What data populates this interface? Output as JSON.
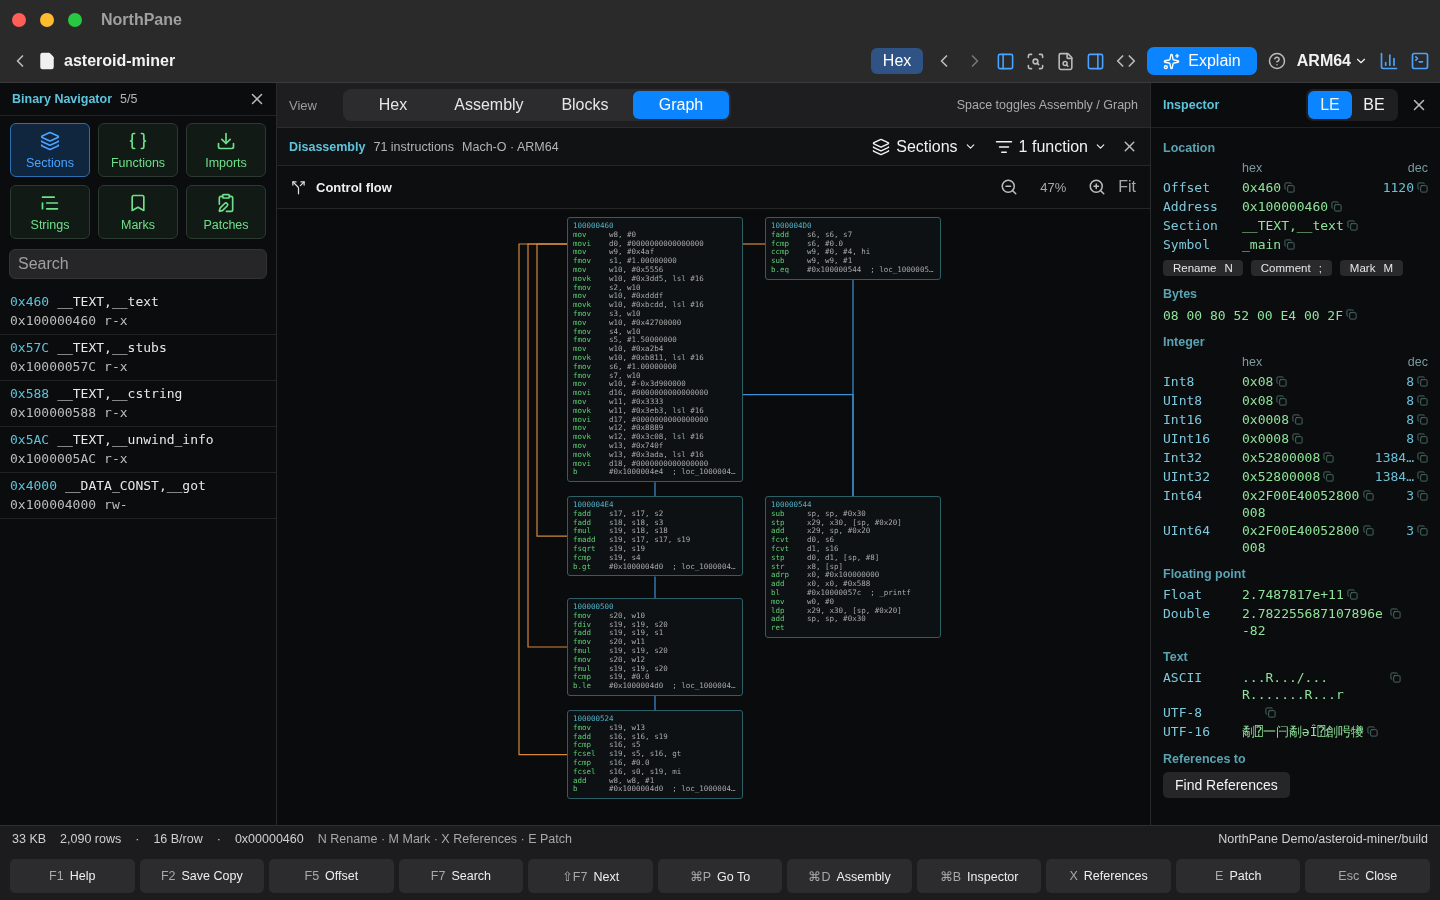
{
  "app": {
    "title": "NorthPane"
  },
  "toolbar": {
    "file_name": "asteroid-miner",
    "mode": "Hex",
    "explain": "Explain",
    "arch": "ARM64"
  },
  "navigator": {
    "title": "Binary Navigator",
    "count": "5/5",
    "categories": [
      {
        "label": "Sections",
        "selected": true
      },
      {
        "label": "Functions",
        "selected": false
      },
      {
        "label": "Imports",
        "selected": false
      },
      {
        "label": "Strings",
        "selected": false
      },
      {
        "label": "Marks",
        "selected": false
      },
      {
        "label": "Patches",
        "selected": false
      }
    ],
    "search": {
      "placeholder": "Search"
    },
    "sections": [
      {
        "offset": "0x460",
        "name": "__TEXT,__text",
        "address": "0x100000460",
        "perms": "r-x"
      },
      {
        "offset": "0x57C",
        "name": "__TEXT,__stubs",
        "address": "0x10000057C",
        "perms": "r-x"
      },
      {
        "offset": "0x588",
        "name": "__TEXT,__cstring",
        "address": "0x100000588",
        "perms": "r-x"
      },
      {
        "offset": "0x5AC",
        "name": "__TEXT,__unwind_info",
        "address": "0x1000005AC",
        "perms": "r-x"
      },
      {
        "offset": "0x4000",
        "name": "__DATA_CONST,__got",
        "address": "0x100004000",
        "perms": "rw-"
      }
    ]
  },
  "view_bar": {
    "label": "View",
    "tabs": [
      {
        "label": "Hex",
        "selected": false
      },
      {
        "label": "Assembly",
        "selected": false
      },
      {
        "label": "Blocks",
        "selected": false
      },
      {
        "label": "Graph",
        "selected": true
      }
    ],
    "hint": "Space toggles Assembly / Graph"
  },
  "disassembly": {
    "title": "Disassembly",
    "count": "71 instructions",
    "format": "Mach-O · ARM64",
    "sections_filter": "Sections",
    "function_filter": "1 function"
  },
  "graph": {
    "title": "Control flow",
    "zoom": "47%",
    "fit": "Fit",
    "blocks": [
      {
        "address": "100000460",
        "instructions": [
          {
            "op": "mov",
            "args": "w8, #0"
          },
          {
            "op": "movi",
            "args": "d0, #0000000000000000"
          },
          {
            "op": "mov",
            "args": "w9, #0x4af"
          },
          {
            "op": "fmov",
            "args": "s1, #1.00000000"
          },
          {
            "op": "mov",
            "args": "w10, #0x5556"
          },
          {
            "op": "movk",
            "args": "w10, #0x3dd5, lsl #16"
          },
          {
            "op": "fmov",
            "args": "s2, w10"
          },
          {
            "op": "mov",
            "args": "w10, #0xdddf"
          },
          {
            "op": "movk",
            "args": "w10, #0xbcdd, lsl #16"
          },
          {
            "op": "fmov",
            "args": "s3, w10"
          },
          {
            "op": "mov",
            "args": "w10, #0x42700000"
          },
          {
            "op": "fmov",
            "args": "s4, w10"
          },
          {
            "op": "fmov",
            "args": "s5, #1.50000000"
          },
          {
            "op": "mov",
            "args": "w10, #0xa2b4"
          },
          {
            "op": "movk",
            "args": "w10, #0xb811, lsl #16"
          },
          {
            "op": "fmov",
            "args": "s6, #1.00000000"
          },
          {
            "op": "fmov",
            "args": "s7, w10"
          },
          {
            "op": "mov",
            "args": "w10, #-0x3d900000"
          },
          {
            "op": "movi",
            "args": "d16, #0000000000000000"
          },
          {
            "op": "mov",
            "args": "w11, #0x3333"
          },
          {
            "op": "movk",
            "args": "w11, #0x3eb3, lsl #16"
          },
          {
            "op": "movi",
            "args": "d17, #0000000000000000"
          },
          {
            "op": "mov",
            "args": "w12, #0x8889"
          },
          {
            "op": "movk",
            "args": "w12, #0x3c08, lsl #16"
          },
          {
            "op": "mov",
            "args": "w13, #0x740f"
          },
          {
            "op": "movk",
            "args": "w13, #0x3ada, lsl #16"
          },
          {
            "op": "movi",
            "args": "d18, #0000000000000000"
          },
          {
            "op": "b",
            "args": "#0x1000004e4  ; loc_1000004…"
          }
        ]
      },
      {
        "address": "1000004D0",
        "instructions": [
          {
            "op": "fadd",
            "args": "s6, s6, s7"
          },
          {
            "op": "fcmp",
            "args": "s6, #0.0"
          },
          {
            "op": "ccmp",
            "args": "w9, #0, #4, hi"
          },
          {
            "op": "sub",
            "args": "w9, w9, #1"
          },
          {
            "op": "b.eq",
            "args": "#0x100000544  ; loc_1000005…"
          }
        ]
      },
      {
        "address": "1000004E4",
        "instructions": [
          {
            "op": "fadd",
            "args": "s17, s17, s2"
          },
          {
            "op": "fadd",
            "args": "s18, s18, s3"
          },
          {
            "op": "fmul",
            "args": "s19, s18, s18"
          },
          {
            "op": "fmadd",
            "args": "s19, s17, s17, s19"
          },
          {
            "op": "fsqrt",
            "args": "s19, s19"
          },
          {
            "op": "fcmp",
            "args": "s19, s4"
          },
          {
            "op": "b.gt",
            "args": "#0x1000004d0  ; loc_1000004…"
          }
        ]
      },
      {
        "address": "100000544",
        "instructions": [
          {
            "op": "sub",
            "args": "sp, sp, #0x30"
          },
          {
            "op": "stp",
            "args": "x29, x30, [sp, #0x20]"
          },
          {
            "op": "add",
            "args": "x29, sp, #0x20"
          },
          {
            "op": "fcvt",
            "args": "d0, s6"
          },
          {
            "op": "fcvt",
            "args": "d1, s16"
          },
          {
            "op": "stp",
            "args": "d0, d1, [sp, #8]"
          },
          {
            "op": "str",
            "args": "x8, [sp]"
          },
          {
            "op": "adrp",
            "args": "x0, #0x100000000"
          },
          {
            "op": "add",
            "args": "x0, x0, #0x588"
          },
          {
            "op": "bl",
            "args": "#0x10000057c  ; _printf"
          },
          {
            "op": "mov",
            "args": "w0, #0"
          },
          {
            "op": "ldp",
            "args": "x29, x30, [sp, #0x20]"
          },
          {
            "op": "add",
            "args": "sp, sp, #0x30"
          },
          {
            "op": "ret"
          }
        ]
      },
      {
        "address": "100000500",
        "instructions": [
          {
            "op": "fmov",
            "args": "s20, w10"
          },
          {
            "op": "fdiv",
            "args": "s19, s19, s20"
          },
          {
            "op": "fadd",
            "args": "s19, s19, s1"
          },
          {
            "op": "fmov",
            "args": "s20, w11"
          },
          {
            "op": "fmul",
            "args": "s19, s19, s20"
          },
          {
            "op": "fmov",
            "args": "s20, w12"
          },
          {
            "op": "fmul",
            "args": "s19, s19, s20"
          },
          {
            "op": "fcmp",
            "args": "s19, #0.0"
          },
          {
            "op": "b.le",
            "args": "#0x1000004d0  ; loc_1000004…"
          }
        ]
      },
      {
        "address": "100000524",
        "instructions": [
          {
            "op": "fmov",
            "args": "s19, w13"
          },
          {
            "op": "fadd",
            "args": "s16, s16, s19"
          },
          {
            "op": "fcmp",
            "args": "s16, s5"
          },
          {
            "op": "fcsel",
            "args": "s19, s5, s16, gt"
          },
          {
            "op": "fcmp",
            "args": "s16, #0.0"
          },
          {
            "op": "fcsel",
            "args": "s16, s0, s19, mi"
          },
          {
            "op": "add",
            "args": "w8, w8, #1"
          },
          {
            "op": "b",
            "args": "#0x1000004d0  ; loc_1000004…"
          }
        ]
      }
    ]
  },
  "inspector": {
    "title": "Inspector",
    "endian": [
      {
        "label": "LE",
        "selected": true
      },
      {
        "label": "BE",
        "selected": false
      }
    ],
    "groups": [
      {
        "kind": "table",
        "heading": "Location",
        "hex_header": "hex",
        "dec_header": "dec",
        "rows": [
          {
            "label": "Offset",
            "hex": "0x460",
            "dec": "1120"
          },
          {
            "label": "Address",
            "hex": "0x100000460"
          },
          {
            "label": "Section",
            "hex": "__TEXT,__text"
          },
          {
            "label": "Symbol",
            "hex": "_main"
          }
        ]
      },
      {
        "kind": "actions",
        "items": [
          {
            "label": "Rename",
            "key": "N"
          },
          {
            "label": "Comment",
            "key": ";"
          },
          {
            "label": "Mark",
            "key": "M"
          }
        ]
      },
      {
        "kind": "bytes",
        "heading": "Bytes",
        "value": "08 00 80 52 00 E4 00 2F"
      },
      {
        "kind": "table",
        "heading": "Integer",
        "hex_header": "hex",
        "dec_header": "dec",
        "rows": [
          {
            "label": "Int8",
            "hex": "0x08",
            "dec": "8"
          },
          {
            "label": "UInt8",
            "hex": "0x08",
            "dec": "8"
          },
          {
            "label": "Int16",
            "hex": "0x0008",
            "dec": "8"
          },
          {
            "label": "UInt16",
            "hex": "0x0008",
            "dec": "8"
          },
          {
            "label": "Int32",
            "hex": "0x52800008",
            "dec": "1384…"
          },
          {
            "label": "UInt32",
            "hex": "0x52800008",
            "dec": "1384…"
          },
          {
            "label": "Int64",
            "hex": "0x2F00E40052800008",
            "dec": "3"
          },
          {
            "label": "UInt64",
            "hex": "0x2F00E40052800008",
            "dec": "3"
          }
        ]
      },
      {
        "kind": "values",
        "heading": "Floating point",
        "rows": [
          {
            "label": "Float",
            "value": "2.7487817e+11"
          },
          {
            "label": "Double",
            "value": "2.782255687107896e-82"
          }
        ]
      },
      {
        "kind": "values",
        "heading": "Text",
        "rows": [
          {
            "label": "ASCII",
            "value": "...R.../...R.......R...r"
          },
          {
            "label": "UTF-8"
          },
          {
            "label": "UTF-16",
            "value": "劀⍰一闩劀əÎ⍰創呺犪"
          }
        ]
      },
      {
        "kind": "button",
        "heading": "References to",
        "label": "Find References"
      }
    ]
  },
  "status_bar": {
    "items": [
      "33 KB",
      "2,090 rows",
      "·",
      "16 B/row",
      "·",
      "0x00000460"
    ],
    "hint": "N Rename · M Mark · X References · E Patch",
    "path": "NorthPane Demo/asteroid-miner/build"
  },
  "function_keys": [
    {
      "key": "F1",
      "label": "Help"
    },
    {
      "key": "F2",
      "label": "Save Copy"
    },
    {
      "key": "F5",
      "label": "Offset"
    },
    {
      "key": "F7",
      "label": "Search"
    },
    {
      "key": "⇧F7",
      "label": "Next"
    },
    {
      "key": "⌘P",
      "label": "Go To"
    },
    {
      "key": "⌘D",
      "label": "Assembly"
    },
    {
      "key": "⌘B",
      "label": "Inspector"
    },
    {
      "key": "X",
      "label": "References"
    },
    {
      "key": "E",
      "label": "Patch"
    },
    {
      "key": "Esc",
      "label": "Close"
    }
  ]
}
